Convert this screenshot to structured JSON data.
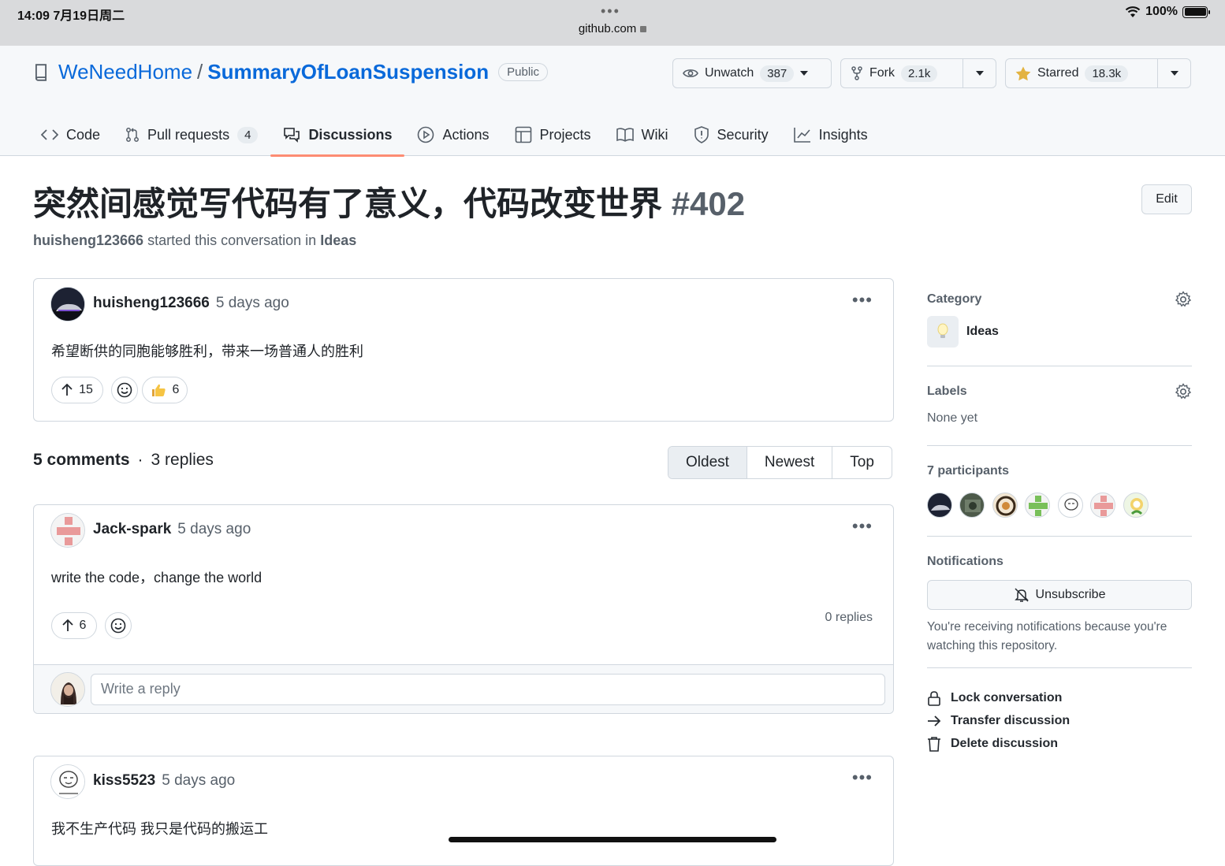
{
  "status_bar": {
    "time_date": "14:09   7月19日周二",
    "url": "github.com",
    "battery": "100%"
  },
  "repo": {
    "owner": "WeNeedHome",
    "name": "SummaryOfLoanSuspension",
    "visibility": "Public",
    "unwatch_label": "Unwatch",
    "watchers": "387",
    "fork_label": "Fork",
    "forks": "2.1k",
    "star_label": "Starred",
    "stars": "18.3k"
  },
  "tabs": [
    {
      "label": "Code"
    },
    {
      "label": "Pull requests",
      "count": "4"
    },
    {
      "label": "Discussions"
    },
    {
      "label": "Actions"
    },
    {
      "label": "Projects"
    },
    {
      "label": "Wiki"
    },
    {
      "label": "Security"
    },
    {
      "label": "Insights"
    }
  ],
  "discussion": {
    "title": "突然间感觉写代码有了意义，代码改变世界",
    "number": "#402",
    "edit_label": "Edit",
    "starter": "huisheng123666",
    "started_text": "started this conversation in",
    "category": "Ideas",
    "post": {
      "author": "huisheng123666",
      "time": "5 days ago",
      "body": "希望断供的同胞能够胜利，带来一场普通人的胜利",
      "upvotes": "15",
      "thumbs": "6"
    }
  },
  "comments_bar": {
    "comments": "5 comments",
    "replies": "3 replies",
    "sort": [
      "Oldest",
      "Newest",
      "Top"
    ]
  },
  "comments": [
    {
      "author": "Jack-spark",
      "time": "5 days ago",
      "body": "write the code，change the world",
      "upvotes": "6",
      "replies": "0 replies",
      "reply_placeholder": "Write a reply"
    },
    {
      "author": "kiss5523",
      "time": "5 days ago",
      "body": "我不生产代码 我只是代码的搬运工"
    }
  ],
  "sidebar": {
    "category_heading": "Category",
    "category": "Ideas",
    "labels_heading": "Labels",
    "labels_value": "None yet",
    "participants_heading": "7 participants",
    "notifications_heading": "Notifications",
    "unsubscribe_label": "Unsubscribe",
    "notification_reason": "You're receiving notifications because you're watching this repository.",
    "actions": [
      "Lock conversation",
      "Transfer discussion",
      "Delete discussion"
    ]
  },
  "colors": {
    "link": "#0969da",
    "tab_underline": "#fd8c73",
    "border": "#d0d7de",
    "muted": "#57606a"
  }
}
